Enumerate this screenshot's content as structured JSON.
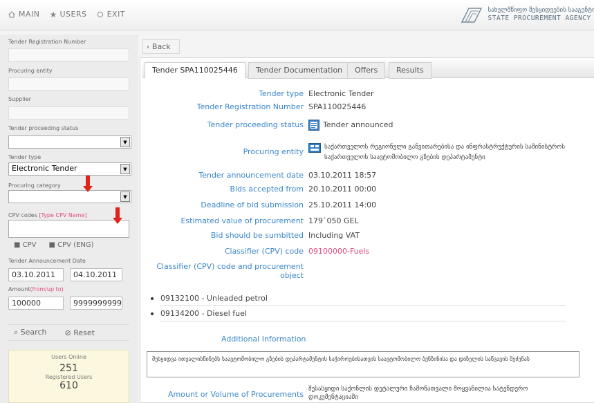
{
  "topnav": {
    "main": "MAIN",
    "users": "USERS",
    "exit": "EXIT"
  },
  "logo": {
    "ka": "სახელმწიფო შესყიდვების სააგენტო",
    "en": "STATE PROCUREMENT AGENCY"
  },
  "sidebar": {
    "tender_reg_label": "Tender Registration Number",
    "procuring_entity_label": "Procuring entity",
    "supplier_label": "Supplier",
    "status_label": "Tender proceeding status",
    "status_value": "",
    "type_label": "Tender type",
    "type_value": "Electronic Tender",
    "category_label": "Procuring category",
    "category_value": "",
    "cpv_label": "CPV codes",
    "cpv_hint": "[Type CPV Name]",
    "cpv_btn": "CPV",
    "cpv_en_btn": "CPV (ENG)",
    "date_label": "Tender Announcement Date",
    "date_from": "03.10.2011",
    "date_to": "04.10.2011",
    "amount_label": "Amount",
    "amount_hint": "(from/up to)",
    "amount_from": "100000",
    "amount_to": "9999999999",
    "search_btn": "Search",
    "reset_btn": "Reset",
    "users_online_label": "Users Online",
    "users_online": "251",
    "registered_label": "Registered Users",
    "registered": "610"
  },
  "back_label": "Back",
  "tabs": [
    "Tender SPA110025446",
    "Tender Documentation",
    "Offers",
    "Results"
  ],
  "details": [
    {
      "label": "Tender type",
      "value": "Electronic Tender"
    },
    {
      "label": "Tender Registration Number",
      "value": "SPA110025446"
    },
    {
      "label": "Tender proceeding status",
      "value": "Tender announced"
    },
    {
      "label": "Procuring entity",
      "value": "საქართველოს რეგიონული განვითარებისა და ინფრასტრუქტურის სამინისტროს საქართველოს საავტომობილო გზების დეპარტამენტი"
    },
    {
      "label": "Tender announcement date",
      "value": "03.10.2011 18:57"
    },
    {
      "label": "Bids accepted from",
      "value": "20.10.2011 00:00"
    },
    {
      "label": "Deadline of bid submission",
      "value": "25.10.2011 14:00"
    },
    {
      "label": "Estimated value of procurement",
      "value": "179`050 GEL"
    },
    {
      "label": "Bid should be sumbitted",
      "value": "Including VAT"
    },
    {
      "label": "Classifier (CPV) code",
      "value": "09100000-Fuels"
    },
    {
      "label": "Classifier (CPV) code and procurement object",
      "value": ""
    }
  ],
  "cpv_items": [
    "09132100 - Unleaded petrol",
    "09134200 - Diesel fuel"
  ],
  "additional_info_label": "Additional Information",
  "additional_info_text": "შესყიდვა ითვალისწინებს საავტომობილო გზების დეპარტამენტის საჭიროებისათვის საავტომობილო ბენზინისა და დიზელის საწვავის შეძენას",
  "amount_label": "Amount or Volume of Procurements",
  "amount_text": "შესასყიდი საქონლის დეტალური ჩამონათვალი მოყვანილია სატენდერო დოკუმენტაციაში",
  "colors": {
    "link": "#3a86c9",
    "accent": "#e04a7a",
    "arrow": "#e0241b"
  }
}
